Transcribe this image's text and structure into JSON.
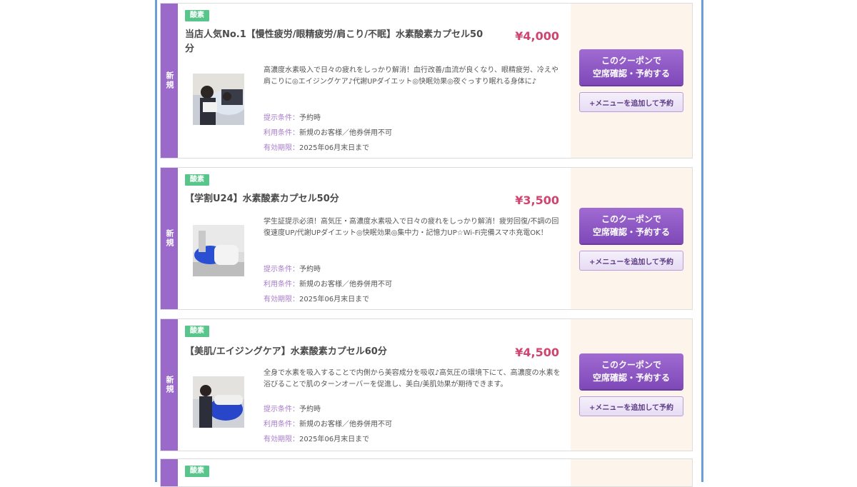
{
  "coupons": [
    {
      "new_label": "新規",
      "tag": "酸素",
      "title": "当店人気No.1【慢性疲労/眼精疲労/肩こり/不眠】水素酸素カプセル50分",
      "price": "¥4,000",
      "description": "高濃度水素吸入で日々の疲れをしっかり解消！血行改善/血流が良くなり、眼精疲労、冷えや肩こりに◎エイジングケア♪代謝UPダイエット◎快眠効果◎夜ぐっすり眠れる身体に♪",
      "cond_present_label": "提示条件：",
      "cond_present": "予約時",
      "cond_use_label": "利用条件：",
      "cond_use": "新規のお客様／他券併用不可",
      "cond_expire_label": "有効期限：",
      "cond_expire": "2025年06月末日まで",
      "btn_main_1": "このクーポンで",
      "btn_main_2": "空席確認・予約する",
      "btn_add": "+メニューを追加して予約"
    },
    {
      "new_label": "新規",
      "tag": "酸素",
      "title": "【学割U24】水素酸素カプセル50分",
      "price": "¥3,500",
      "description": "学生証提示必須！高気圧・高濃度水素吸入で日々の疲れをしっかり解消！疲労回復/不調の回復速度UP/代謝UPダイエット◎快眠効果◎集中力・記憶力UP☆Wi-Fi完備スマホ充電OK！",
      "cond_present_label": "提示条件：",
      "cond_present": "予約時",
      "cond_use_label": "利用条件：",
      "cond_use": "新規のお客様／他券併用不可",
      "cond_expire_label": "有効期限：",
      "cond_expire": "2025年06月末日まで",
      "btn_main_1": "このクーポンで",
      "btn_main_2": "空席確認・予約する",
      "btn_add": "+メニューを追加して予約"
    },
    {
      "new_label": "新規",
      "tag": "酸素",
      "title": "【美肌/エイジングケア】水素酸素カプセル60分",
      "price": "¥4,500",
      "description": "全身で水素を吸入することで内側から美容成分を吸収♪高気圧の環境下にて、高濃度の水素を浴びることで肌のターンオーバーを促進し、美白/美肌効果が期待できます。",
      "cond_present_label": "提示条件：",
      "cond_present": "予約時",
      "cond_use_label": "利用条件：",
      "cond_use": "新規のお客様／他券併用不可",
      "cond_expire_label": "有効期限：",
      "cond_expire": "2025年06月末日まで",
      "btn_main_1": "このクーポンで",
      "btn_main_2": "空席確認・予約する",
      "btn_add": "+メニューを追加して予約"
    },
    {
      "tag": "酸素"
    }
  ]
}
